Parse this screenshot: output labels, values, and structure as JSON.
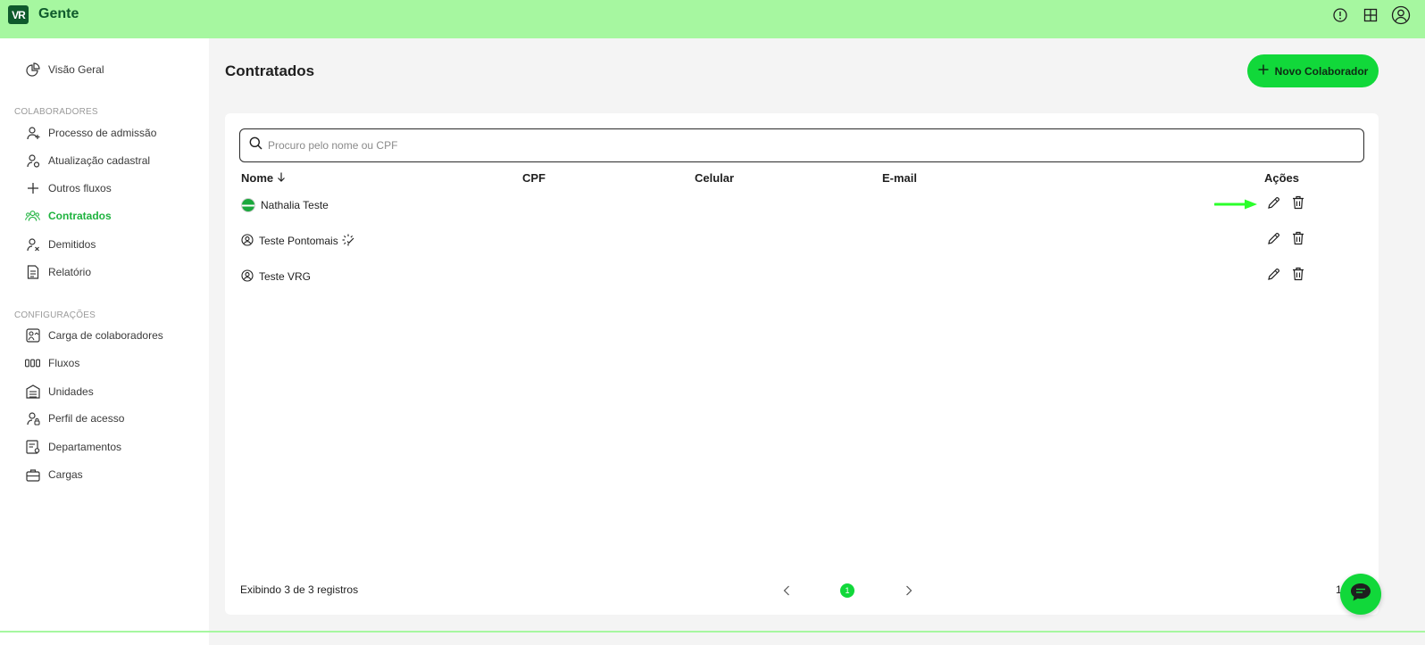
{
  "app": {
    "logo_text": "VR",
    "title": "Gente"
  },
  "topbar": {
    "icons": [
      "alert-circle-icon",
      "grid-icon",
      "user-circle-icon"
    ]
  },
  "sidebar": {
    "overview": "Visão Geral",
    "section_colaboradores": "COLABORADORES",
    "colaboradores_items": [
      {
        "label": "Processo de admissão",
        "icon": "user-plus-icon"
      },
      {
        "label": "Atualização cadastral",
        "icon": "user-edit-icon"
      },
      {
        "label": "Outros fluxos",
        "icon": "plus-icon"
      },
      {
        "label": "Contratados",
        "icon": "users-icon",
        "active": true
      },
      {
        "label": "Demitidos",
        "icon": "user-x-icon"
      },
      {
        "label": "Relatório",
        "icon": "report-icon"
      }
    ],
    "section_configuracoes": "CONFIGURAÇÕES",
    "config_items": [
      {
        "label": "Carga de colaboradores",
        "icon": "upload-icon"
      },
      {
        "label": "Fluxos",
        "icon": "flow-icon"
      },
      {
        "label": "Unidades",
        "icon": "building-icon"
      },
      {
        "label": "Perfil de acesso",
        "icon": "user-lock-icon"
      },
      {
        "label": "Departamentos",
        "icon": "department-icon"
      },
      {
        "label": "Cargas",
        "icon": "briefcase-icon"
      }
    ]
  },
  "main": {
    "title": "Contratados",
    "new_button": "Novo Colaborador",
    "search_placeholder": "Procuro pelo nome ou CPF",
    "columns": {
      "name": "Nome",
      "cpf": "CPF",
      "phone": "Celular",
      "email": "E-mail",
      "actions": "Ações"
    },
    "rows": [
      {
        "name": "Nathalia Teste",
        "avatar": "green-flag-avatar"
      },
      {
        "name": "Teste Pontomais",
        "avatar": "user-circle-icon",
        "badge": "loading-check-icon"
      },
      {
        "name": "Teste VRG",
        "avatar": "user-circle-icon"
      }
    ],
    "footer": {
      "summary": "Exibindo 3 de 3 registros",
      "current_page": "1",
      "stray": "1"
    }
  },
  "colors": {
    "accent": "#11d83a",
    "topbar": "#a6f7a0",
    "brand_dark": "#0f5a2c",
    "active_nav": "#1fb33f"
  }
}
